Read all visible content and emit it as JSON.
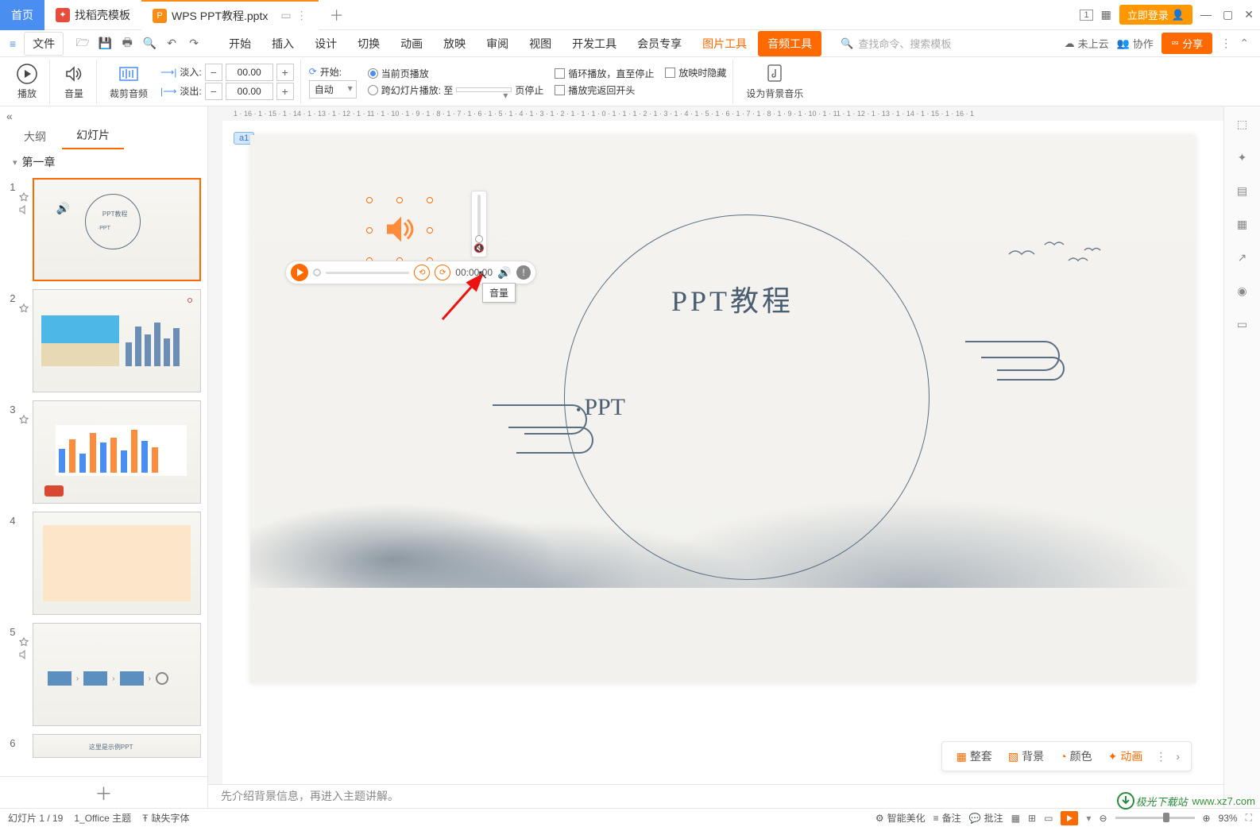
{
  "titlebar": {
    "home": "首页",
    "template": "找稻壳模板",
    "doc": "WPS PPT教程.pptx",
    "login": "立即登录"
  },
  "toolbar": {
    "file": "文件",
    "search_placeholder": "查找命令、搜索模板",
    "cloud": "未上云",
    "collab": "协作",
    "share": "分享"
  },
  "menu": {
    "start": "开始",
    "insert": "插入",
    "design": "设计",
    "transition": "切换",
    "animation": "动画",
    "slideshow": "放映",
    "review": "审阅",
    "view": "视图",
    "dev": "开发工具",
    "member": "会员专享",
    "pic": "图片工具",
    "audio": "音频工具"
  },
  "ribbon": {
    "play": "播放",
    "volume": "音量",
    "trim": "裁剪音频",
    "fadein": "淡入:",
    "fadeout": "淡出:",
    "fadein_val": "00.00",
    "fadeout_val": "00.00",
    "start_label": "开始:",
    "auto": "自动",
    "opt_current": "当前页播放",
    "opt_cross": "跨幻灯片播放: 至",
    "page_stop": "页停止",
    "loop": "循环播放，直至停止",
    "hide": "放映时隐藏",
    "rewind": "播放完返回开头",
    "bgm": "设为背景音乐"
  },
  "panel": {
    "collapse": "«",
    "outline": "大纲",
    "slides": "幻灯片",
    "chapter": "第一章",
    "thumbs": [
      1,
      2,
      3,
      4,
      5,
      6
    ]
  },
  "slide": {
    "comment_a1": "a1",
    "comment_a2": "a1",
    "title": "PPT教程",
    "sub": "PPT",
    "time": "00:00.00",
    "tooltip": "音量"
  },
  "float": {
    "arrange": "整套",
    "bg": "背景",
    "color": "颜色",
    "anim": "动画"
  },
  "notes": "先介绍背景信息，再进入主题讲解。",
  "status": {
    "page": "幻灯片 1 / 19",
    "theme": "1_Office 主题",
    "missing_font": "缺失字体",
    "beautify": "智能美化",
    "notes": "备注",
    "comments": "批注",
    "zoom": "93%"
  },
  "watermark": {
    "name": "极光下载站",
    "url": "www.xz7.com"
  },
  "ruler": "1 · 16 · 1 · 15 · 1 · 14 · 1 · 13 · 1 · 12 · 1 · 11 · 1 · 10 · 1 · 9 · 1 · 8 · 1 · 7 · 1 · 6 · 1 · 5 · 1 · 4 · 1 · 3 · 1 · 2 · 1 · 1 · 1 · 0 · 1 · 1 · 1 · 2 · 1 · 3 · 1 · 4 · 1 · 5 · 1 · 6 · 1 · 7 · 1 · 8 · 1 · 9 · 1 · 10 · 1 · 11 · 1 · 12 · 1 · 13 · 1 · 14 · 1 · 15 · 1 · 16 · 1"
}
